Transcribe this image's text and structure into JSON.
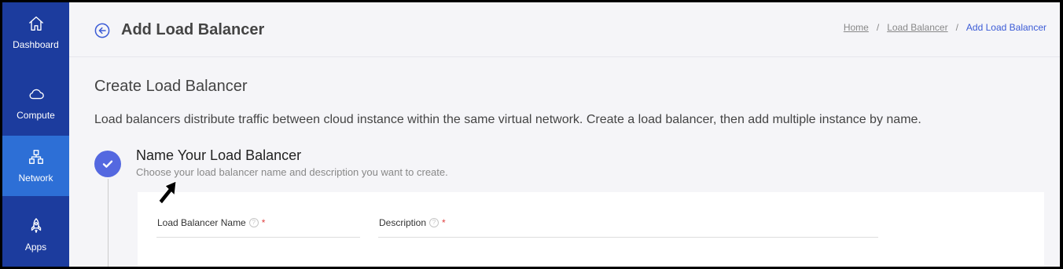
{
  "sidebar": {
    "items": [
      {
        "label": "Dashboard",
        "icon": "home-icon",
        "active": false
      },
      {
        "label": "Compute",
        "icon": "cloud-icon",
        "active": false
      },
      {
        "label": "Network",
        "icon": "network-icon",
        "active": true
      },
      {
        "label": "Apps",
        "icon": "rocket-icon",
        "active": false
      }
    ]
  },
  "header": {
    "title": "Add Load Balancer",
    "back_icon": "arrow-left-circle-icon",
    "breadcrumb": {
      "home": "Home",
      "separator": "/",
      "load_balancer": "Load Balancer",
      "current": "Add Load Balancer"
    }
  },
  "main": {
    "section_title": "Create Load Balancer",
    "intro": "Load balancers distribute traffic between cloud instance within the same virtual network. Create a load balancer, then add multiple instance by name.",
    "step": {
      "icon": "check-icon",
      "title": "Name Your Load Balancer",
      "subtitle": "Choose your load balancer name and description you want to create."
    },
    "form": {
      "name_label": "Load Balancer Name",
      "name_value": "",
      "description_label": "Description",
      "description_value": "",
      "help_glyph": "?",
      "required_mark": "*"
    }
  },
  "colors": {
    "sidebar": "#1c3c9e",
    "sidebar_active": "#2d6fd6",
    "accent": "#5468e0",
    "link_active": "#3b5bd6",
    "required": "#e04343"
  }
}
